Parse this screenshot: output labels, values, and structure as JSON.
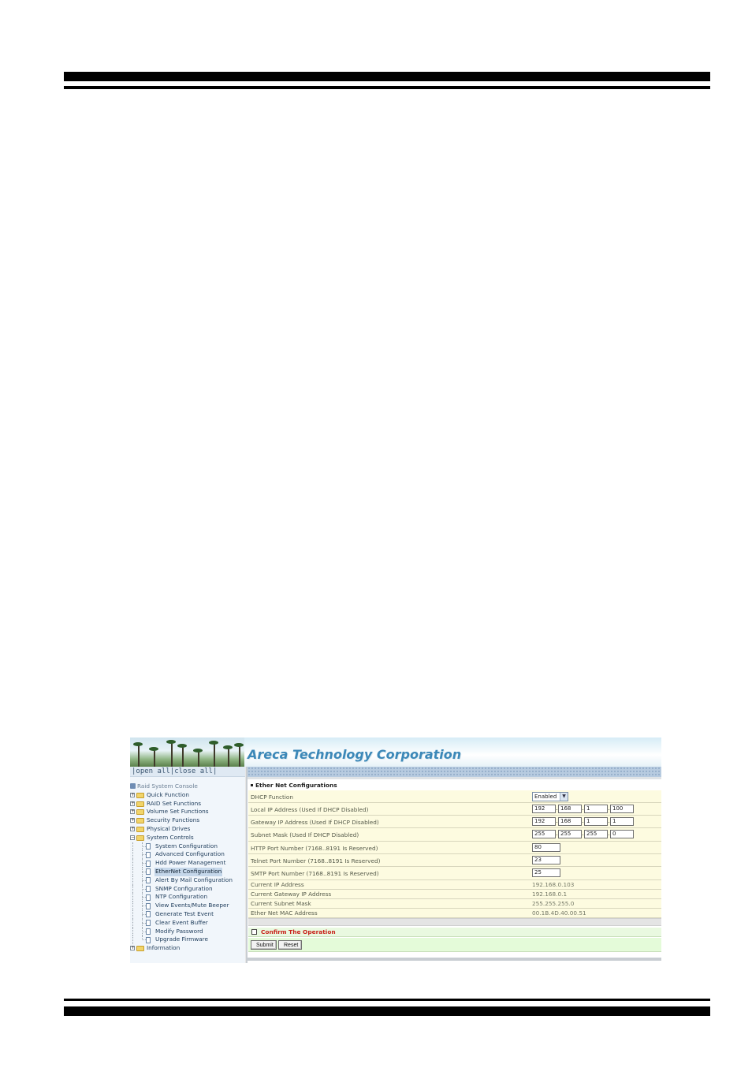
{
  "banner": {
    "title": "Areca Technology Corporation"
  },
  "sidebar": {
    "open_all": "|open all|",
    "close_all": "close all|",
    "root": "Raid System Console",
    "folders": [
      "Quick Function",
      "RAID Set Functions",
      "Volume Set Functions",
      "Security Functions",
      "Physical Drives",
      "System Controls"
    ],
    "system_controls_items": [
      "System Configuration",
      "Advanced Configuration",
      "Hdd Power Management",
      "EtherNet Configuration",
      "Alert By Mail Configuration",
      "SNMP Configuration",
      "NTP Configuration",
      "View Events/Mute Beeper",
      "Generate Test Event",
      "Clear Event Buffer",
      "Modify Password",
      "Upgrade Firmware"
    ],
    "information": "Information",
    "selected_item": "EtherNet Configuration"
  },
  "main": {
    "section_title": "Ether Net Configurations",
    "dhcp": {
      "label": "DHCP Function",
      "value": "Enabled"
    },
    "local_ip": {
      "label": "Local IP Address (Used If DHCP Disabled)",
      "octets": [
        "192",
        "168",
        "1",
        "100"
      ]
    },
    "gateway_ip": {
      "label": "Gateway IP Address (Used If DHCP Disabled)",
      "octets": [
        "192",
        "168",
        "1",
        "1"
      ]
    },
    "subnet_mask": {
      "label": "Subnet Mask (Used If DHCP Disabled)",
      "octets": [
        "255",
        "255",
        "255",
        "0"
      ]
    },
    "http_port": {
      "label": "HTTP Port Number (7168..8191 Is Reserved)",
      "value": "80"
    },
    "telnet_port": {
      "label": "Telnet Port Number (7168..8191 Is Reserved)",
      "value": "23"
    },
    "smtp_port": {
      "label": "SMTP Port Number (7168..8191 Is Reserved)",
      "value": "25"
    },
    "current_ip": {
      "label": "Current IP Address",
      "value": "192.168.0.103"
    },
    "current_gateway": {
      "label": "Current Gateway IP Address",
      "value": "192.168.0.1"
    },
    "current_subnet": {
      "label": "Current Subnet Mask",
      "value": "255.255.255.0"
    },
    "mac_address": {
      "label": "Ether Net MAC Address",
      "value": "00.1B.4D.40.00.51"
    },
    "confirm_label": "Confirm The Operation",
    "submit_label": "Submit",
    "reset_label": "Reset"
  }
}
